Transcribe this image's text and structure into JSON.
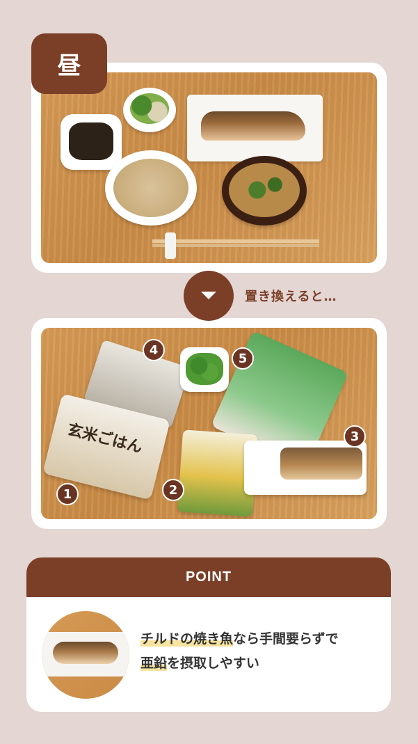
{
  "top_section": {
    "time_label": "昼"
  },
  "transition": {
    "text": "置き換えると…"
  },
  "items": [
    {
      "number": "1",
      "package_text": "玄米ごはん"
    },
    {
      "number": "2"
    },
    {
      "number": "3"
    },
    {
      "number": "4"
    },
    {
      "number": "5"
    }
  ],
  "point": {
    "header": "POINT",
    "line1_highlight": "チルドの焼き魚",
    "line1_rest": "なら手間要らずで",
    "line2_highlight": "亜鉛",
    "line2_rest": "を摂取しやすい"
  },
  "colors": {
    "background": "#e3d6d3",
    "accent_brown": "#7b3f27",
    "highlight_yellow": "#f6e3a0"
  }
}
